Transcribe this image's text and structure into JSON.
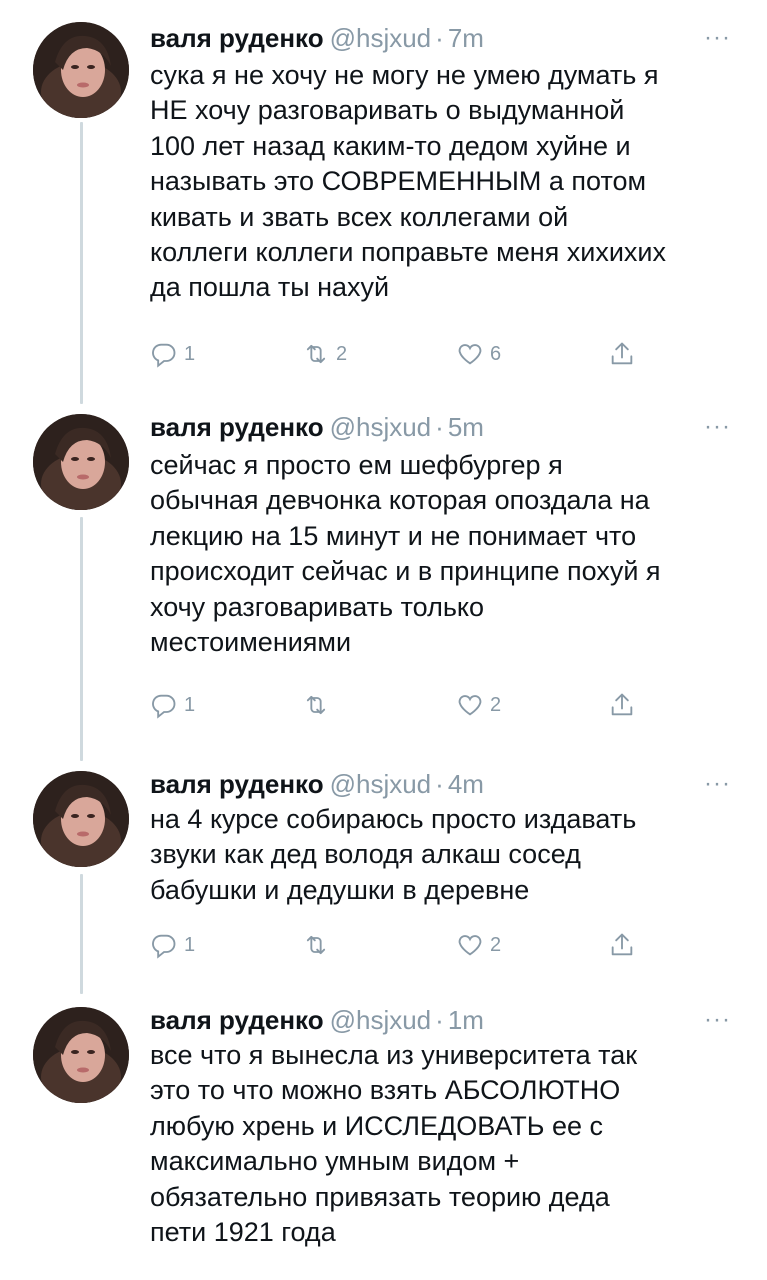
{
  "tweets": [
    {
      "name": "валя руденко",
      "handle": "@hsjxud",
      "time": "7m",
      "more": "···",
      "text": "сука я не хочу не могу не умею думать я\nНЕ хочу разговаривать о выдуманной\n100 лет назад каким-то дедом хуйне и\nназывать это СОВРЕМЕННЫМ а потом\nкивать и звать всех коллегами ой\nколлеги коллеги поправьте меня хихихих\nда пошла ты нахуй",
      "replies": "1",
      "retweets": "2",
      "likes": "6"
    },
    {
      "name": "валя руденко",
      "handle": "@hsjxud",
      "time": "5m",
      "more": "···",
      "text": "сейчас я просто ем шефбургер я\nобычная девчонка которая опоздала на\nлекцию на 15 минут и не понимает что\nпроисходит сейчас и в принципе похуй я\nхочу разговаривать только\nместоимениями",
      "replies": "1",
      "retweets": "",
      "likes": "2"
    },
    {
      "name": "валя руденко",
      "handle": "@hsjxud",
      "time": "4m",
      "more": "···",
      "text": "на 4 курсе собираюсь просто издавать\nзвуки как дед володя алкаш сосед\nбабушки и дедушки в деревне",
      "replies": "1",
      "retweets": "",
      "likes": "2"
    },
    {
      "name": "валя руденко",
      "handle": "@hsjxud",
      "time": "1m",
      "more": "···",
      "text": "все что я вынесла из университета так\nэто то что можно взять АБСОЛЮТНО\nлюбую хрень и ИССЛЕДОВАТЬ ее с\nмаксимально умным видом +\nобязательно привязать теорию деда\nпети 1921 года"
    }
  ],
  "icons": {
    "reply": "reply-icon",
    "retweet": "retweet-icon",
    "like": "heart-icon",
    "share": "share-icon"
  },
  "colors": {
    "text": "#0f1419",
    "secondary": "#8899a6",
    "thread_line": "#cfd9de"
  }
}
